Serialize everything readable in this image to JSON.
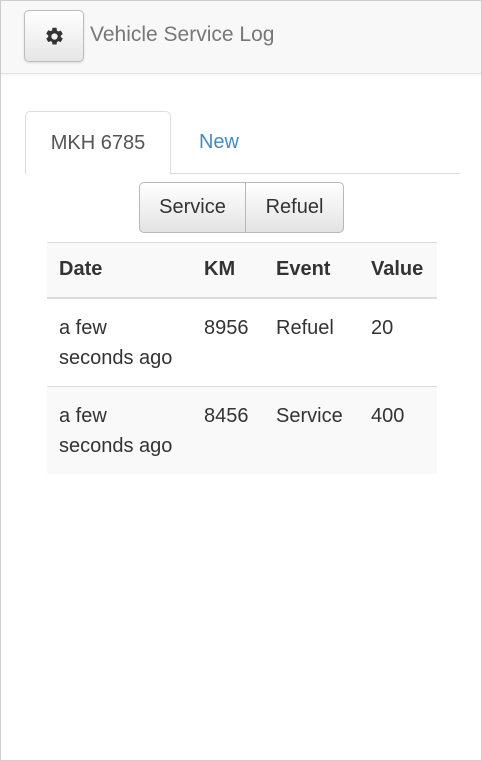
{
  "header": {
    "settings_icon": "gear-icon",
    "title": "Vehicle Service Log"
  },
  "tabs": [
    {
      "label": "MKH 6785",
      "active": true
    },
    {
      "label": "New",
      "active": false
    }
  ],
  "actions": {
    "service_label": "Service",
    "refuel_label": "Refuel"
  },
  "table": {
    "columns": [
      "Date",
      "KM",
      "Event",
      "Value"
    ],
    "rows": [
      {
        "date": "a few seconds ago",
        "km": "8956",
        "event": "Refuel",
        "value": "20"
      },
      {
        "date": "a few seconds ago",
        "km": "8456",
        "event": "Service",
        "value": "400"
      }
    ]
  },
  "colors": {
    "link": "#428bca",
    "navbar_bg": "#f8f8f8",
    "text": "#333333"
  }
}
